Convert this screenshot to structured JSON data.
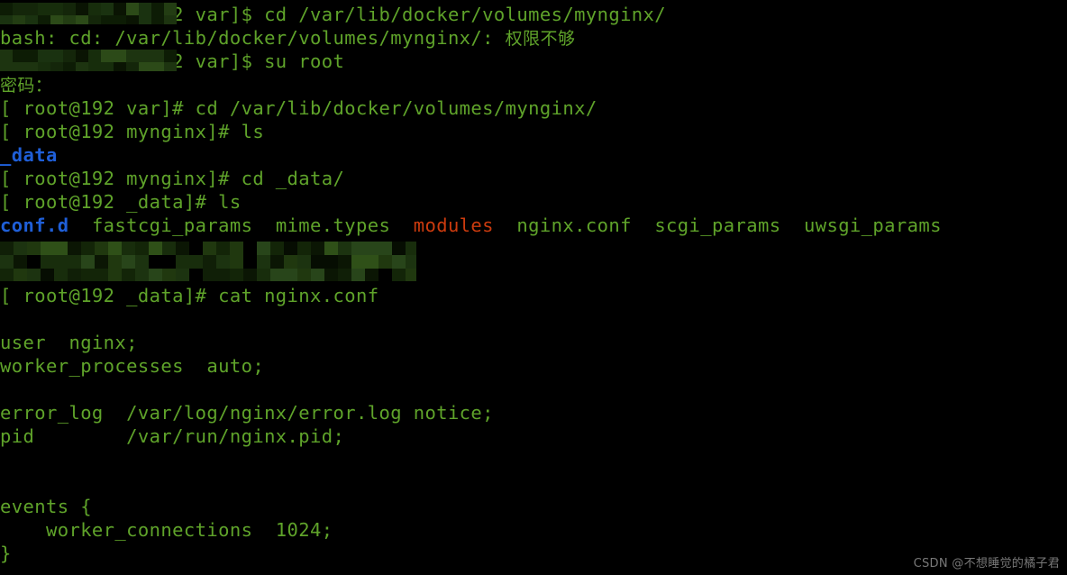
{
  "terminal": {
    "background_color": "#000000",
    "foreground_color": "#5fa32a",
    "dir_color": "#1f5fd8",
    "archive_color": "#cc3b0e",
    "font_size_px": 20.5,
    "line_height_px": 26,
    "columns_visible": 58,
    "lines": [
      {
        "id": "line-1",
        "kind": "prompt-command",
        "redacted_user": true,
        "prompt": "@192 var]$ ",
        "command": "cd /var/lib/docker/volumes/mynginx/",
        "text": "[ <redacted>@192 var]$ cd /var/lib/docker/volumes/mynginx/"
      },
      {
        "id": "line-2",
        "kind": "error",
        "text": "bash: cd: /var/lib/docker/volumes/mynginx/: ",
        "text_cn": "权限不够"
      },
      {
        "id": "line-3",
        "kind": "prompt-command",
        "redacted_user": true,
        "prompt": "@192 var]$ ",
        "command": "su root",
        "text": "[ <redacted>@192 var]$ su root"
      },
      {
        "id": "line-4",
        "kind": "password-prompt",
        "text_cn": "密码："
      },
      {
        "id": "line-5",
        "kind": "prompt-command",
        "text": "[ root@192 var]# cd /var/lib/docker/volumes/mynginx/"
      },
      {
        "id": "line-6",
        "kind": "prompt-command",
        "text": "[ root@192 mynginx]# ls"
      },
      {
        "id": "line-7",
        "kind": "ls-output",
        "entries": [
          {
            "name": "_data",
            "type": "directory",
            "color": "#1f5fd8"
          }
        ]
      },
      {
        "id": "line-8",
        "kind": "prompt-command",
        "text": "[ root@192 mynginx]# cd _data/"
      },
      {
        "id": "line-9",
        "kind": "prompt-command",
        "text": "[ root@192 _data]# ls"
      },
      {
        "id": "line-10",
        "kind": "ls-output",
        "entries": [
          {
            "name": "conf.d",
            "type": "directory",
            "color": "#1f5fd8"
          },
          {
            "name": "fastcgi_params",
            "type": "file",
            "color": "#5fa32a"
          },
          {
            "name": "mime.types",
            "type": "file",
            "color": "#5fa32a"
          },
          {
            "name": "modules",
            "type": "archive",
            "color": "#cc3b0e"
          },
          {
            "name": "nginx.conf",
            "type": "file",
            "color": "#5fa32a"
          },
          {
            "name": "scgi_params",
            "type": "file",
            "color": "#5fa32a"
          },
          {
            "name": "uwsgi_params",
            "type": "file",
            "color": "#5fa32a"
          }
        ]
      },
      {
        "id": "line-11",
        "kind": "redacted-block",
        "text": ""
      },
      {
        "id": "line-12",
        "kind": "redacted-block",
        "text": ""
      },
      {
        "id": "line-13",
        "kind": "prompt-command",
        "text": "[ root@192 _data]# cat nginx.conf"
      },
      {
        "id": "line-14",
        "kind": "blank",
        "text": ""
      },
      {
        "id": "line-15",
        "kind": "conf",
        "text": "user  nginx;"
      },
      {
        "id": "line-16",
        "kind": "conf",
        "text": "worker_processes  auto;"
      },
      {
        "id": "line-17",
        "kind": "blank",
        "text": ""
      },
      {
        "id": "line-18",
        "kind": "conf",
        "text": "error_log  /var/log/nginx/error.log notice;"
      },
      {
        "id": "line-19",
        "kind": "conf",
        "text": "pid        /var/run/nginx.pid;"
      },
      {
        "id": "line-20",
        "kind": "blank",
        "text": ""
      },
      {
        "id": "line-21",
        "kind": "blank",
        "text": ""
      },
      {
        "id": "line-22",
        "kind": "conf",
        "text": "events {"
      },
      {
        "id": "line-23",
        "kind": "conf",
        "text": "    worker_connections  1024;"
      },
      {
        "id": "line-24",
        "kind": "conf",
        "text": "}"
      }
    ]
  },
  "watermark": {
    "text": "CSDN @不想睡觉的橘子君",
    "color": "#8d8d8d"
  }
}
